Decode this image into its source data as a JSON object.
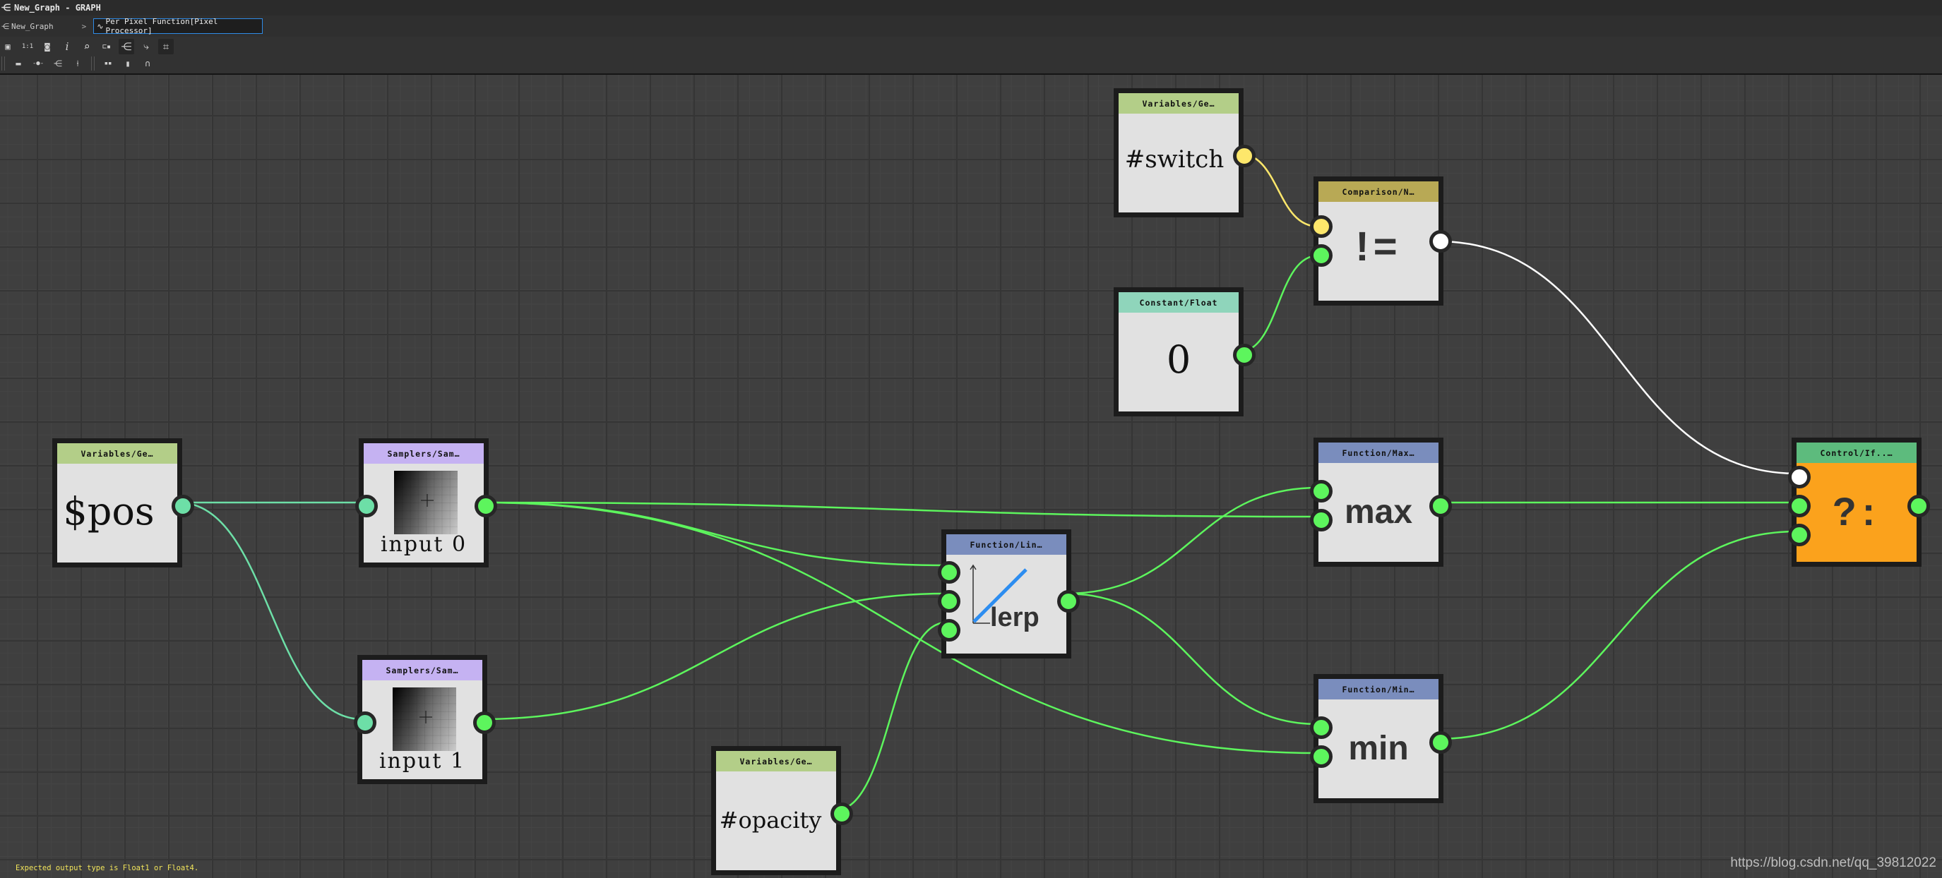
{
  "window": {
    "title": "New_Graph - GRAPH",
    "title_icon": "graph-icon"
  },
  "breadcrumb": {
    "items": [
      {
        "label": "New_Graph",
        "icon": "graph-icon"
      },
      {
        "label": "Per Pixel Function[Pixel Processor]",
        "icon": "function-icon"
      }
    ],
    "separator": ">"
  },
  "toolbar": {
    "row1": [
      {
        "name": "frame-all",
        "glyph": "▣",
        "active": false
      },
      {
        "name": "zoom-1to1",
        "glyph": "1:1",
        "active": false
      },
      {
        "name": "screenshot",
        "glyph": "📷",
        "active": false
      },
      {
        "name": "info",
        "glyph": "i",
        "active": false
      },
      {
        "name": "search",
        "glyph": "⌕",
        "active": false
      },
      {
        "name": "node-link",
        "glyph": "⊏▪",
        "active": false
      },
      {
        "name": "graph-layout",
        "glyph": "⋲",
        "active": true
      },
      {
        "name": "link-style",
        "glyph": "⤷",
        "active": false
      },
      {
        "name": "snap-grid",
        "glyph": "⌗",
        "active": true
      }
    ],
    "row2": [
      {
        "name": "comment",
        "glyph": "▬"
      },
      {
        "name": "dot-node",
        "glyph": "-●-"
      },
      {
        "name": "frame",
        "glyph": "⋲"
      },
      {
        "name": "pin",
        "glyph": "⍿"
      },
      {
        "name": "align-horizontal",
        "glyph": "▪▪"
      },
      {
        "name": "align-vertical",
        "glyph": "▮"
      },
      {
        "name": "distribute",
        "glyph": "∩"
      }
    ]
  },
  "nodes": {
    "pos": {
      "category": "Variables/Ge…",
      "label": "$pos",
      "header_color": "#b3ce88"
    },
    "sampler0": {
      "category": "Samplers/Sam…",
      "label": "input 0",
      "header_color": "#c5b2f2"
    },
    "sampler1": {
      "category": "Samplers/Sam…",
      "label": "input 1",
      "header_color": "#c5b2f2"
    },
    "opacity": {
      "category": "Variables/Ge…",
      "label": "#opacity",
      "header_color": "#b3ce88"
    },
    "lerp": {
      "category": "Function/Lin…",
      "label": "lerp",
      "header_color": "#7a8dbd"
    },
    "switch": {
      "category": "Variables/Ge…",
      "label": "#switch",
      "header_color": "#b3ce88"
    },
    "constant": {
      "category": "Constant/Float",
      "label": "0",
      "header_color": "#8fd5bb"
    },
    "compare": {
      "category": "Comparison/N…",
      "label": "!=",
      "header_color": "#b8a955"
    },
    "max": {
      "category": "Function/Max…",
      "label": "max",
      "header_color": "#7a8dbd"
    },
    "min": {
      "category": "Function/Min…",
      "label": "min",
      "header_color": "#7a8dbd"
    },
    "if": {
      "category": "Control/If..…",
      "label": "?:",
      "header_color": "#5dbb7d",
      "body_color": "#fba21c"
    }
  },
  "links": [
    {
      "from": "pos.out",
      "to": "sampler0.in",
      "type": "float2"
    },
    {
      "from": "pos.out",
      "to": "sampler1.in",
      "type": "float2"
    },
    {
      "from": "sampler0.out",
      "to": "lerp.in0",
      "type": "float4"
    },
    {
      "from": "sampler0.out",
      "to": "max.in1",
      "type": "float4"
    },
    {
      "from": "sampler0.out",
      "to": "min.in1",
      "type": "float4"
    },
    {
      "from": "sampler1.out",
      "to": "lerp.in1",
      "type": "float4"
    },
    {
      "from": "opacity.out",
      "to": "lerp.in2",
      "type": "float4"
    },
    {
      "from": "lerp.out",
      "to": "max.in0",
      "type": "float4"
    },
    {
      "from": "lerp.out",
      "to": "min.in0",
      "type": "float4"
    },
    {
      "from": "switch.out",
      "to": "compare.in0",
      "type": "integer"
    },
    {
      "from": "constant.out",
      "to": "compare.in1",
      "type": "float4"
    },
    {
      "from": "compare.out",
      "to": "if.in0",
      "type": "bool"
    },
    {
      "from": "max.out",
      "to": "if.in1",
      "type": "float4"
    },
    {
      "from": "min.out",
      "to": "if.in2",
      "type": "float4"
    }
  ],
  "colors": {
    "float4": "#5df55d",
    "float2": "#6ddfa7",
    "integer": "#fde76b",
    "bool": "#ffffff"
  },
  "status": {
    "message": "Expected output type is Float1 or Float4."
  },
  "watermark": "https://blog.csdn.net/qq_39812022"
}
